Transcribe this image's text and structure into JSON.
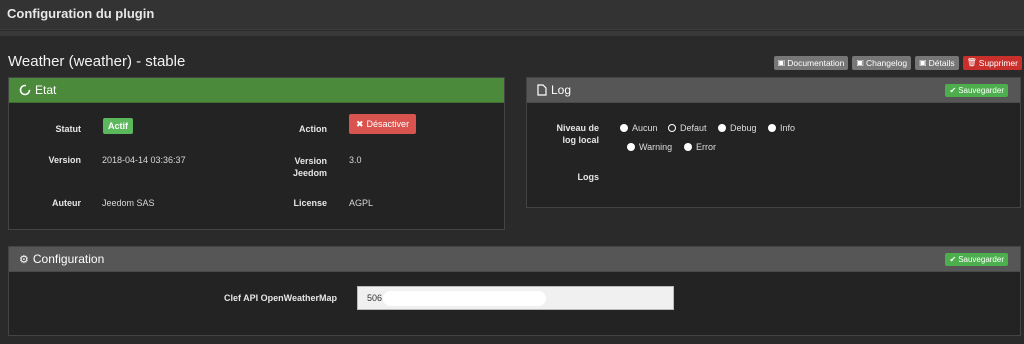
{
  "page": {
    "title": "Configuration du plugin"
  },
  "plugin": {
    "title": "Weather (weather) - stable"
  },
  "toolbar": {
    "documentation": "Documentation",
    "changelog": "Changelog",
    "details": "Détails",
    "delete": "Supprimer"
  },
  "etat": {
    "title": "Etat",
    "statut_label": "Statut",
    "statut_value": "Actif",
    "action_label": "Action",
    "action_button": "Désactiver",
    "version_label": "Version",
    "version_value": "2018-04-14 03:36:37",
    "version_jeedom_label": "Version Jeedom",
    "version_jeedom_value": "3.0",
    "auteur_label": "Auteur",
    "auteur_value": "Jeedom SAS",
    "license_label": "License",
    "license_value": "AGPL"
  },
  "log": {
    "title": "Log",
    "save": "Sauvegarder",
    "niveau_label": "Niveau de log local",
    "options": [
      "Aucun",
      "Defaut",
      "Debug",
      "Info",
      "Warning",
      "Error"
    ],
    "selected": "Defaut",
    "logs_label": "Logs"
  },
  "config": {
    "title": "Configuration",
    "save": "Sauvegarder",
    "api_label": "Clef API OpenWeatherMap",
    "api_value": "506"
  },
  "colors": {
    "green_header": "#4b8a3a",
    "grey_header": "#565656",
    "danger": "#d9534f",
    "success": "#5cb85c"
  }
}
